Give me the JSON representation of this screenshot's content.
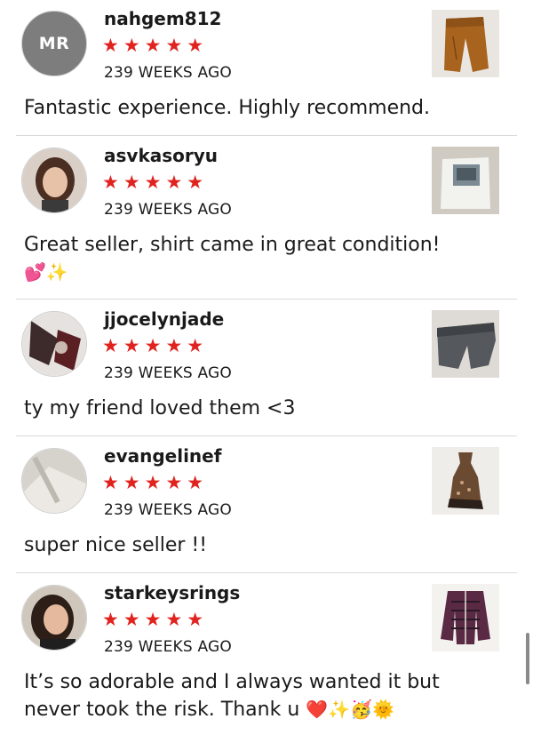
{
  "reviews": [
    {
      "username": "nahgem812",
      "initials": "MR",
      "stars": "★★★★★",
      "time": "239 WEEKS AGO",
      "text": "Fantastic experience. Highly recommend."
    },
    {
      "username": "asvkasoryu",
      "stars": "★★★★★",
      "time": "239 WEEKS AGO",
      "text": "Great seller, shirt came in great condition!",
      "emoji": "💕✨"
    },
    {
      "username": "jjocelynjade",
      "stars": "★★★★★",
      "time": "239 WEEKS AGO",
      "text": "ty my friend loved them <3"
    },
    {
      "username": "evangelinef",
      "stars": "★★★★★",
      "time": "239 WEEKS AGO",
      "text": "super nice seller !!"
    },
    {
      "username": "starkeysrings",
      "stars": "★★★★★",
      "time": "239 WEEKS AGO",
      "text_line1": "It’s so adorable and I always wanted it but",
      "text_line2": "never took the risk. Thank u",
      "emoji": "❤️✨🥳🌞"
    }
  ],
  "colors": {
    "star": "#e0231f",
    "divider": "#d9d9d9",
    "avatar_initials_bg": "#7d7d7d"
  }
}
